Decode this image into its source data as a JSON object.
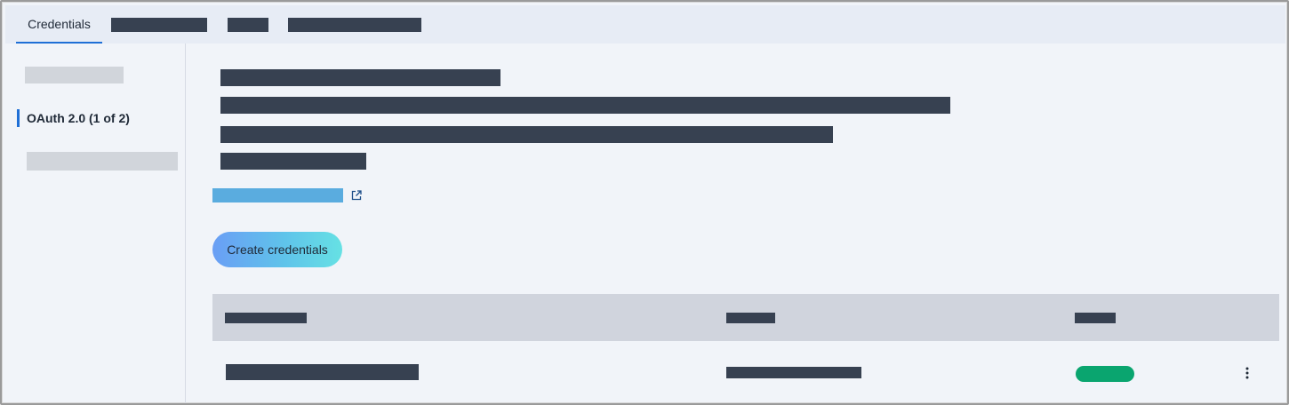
{
  "tabs": [
    {
      "label": "Credentials",
      "active": true
    },
    {
      "label": ""
    },
    {
      "label": ""
    },
    {
      "label": ""
    }
  ],
  "leftnav": {
    "items": [
      {
        "label": ""
      },
      {
        "label": "OAuth 2.0 (1 of 2)",
        "active": true
      },
      {
        "label": ""
      }
    ]
  },
  "main": {
    "create_button_label": "Create credentials",
    "link_icon": "external-link-icon"
  },
  "table": {
    "headers": [
      "",
      "",
      ""
    ],
    "rows": [
      {
        "cells": [
          "",
          ""
        ],
        "status_icon": "status-pill",
        "menu_icon": "more-vertical-icon"
      }
    ]
  },
  "colors": {
    "accent": "#1f6fd6",
    "status_active": "#0aa56f",
    "link": "#5aacdf",
    "button_gradient_start": "#6a9ef5",
    "button_gradient_end": "#66e1e4"
  }
}
